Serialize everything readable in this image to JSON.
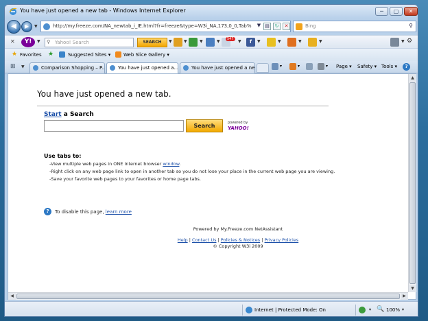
{
  "window": {
    "title": "You have just opened a new tab - Windows Internet Explorer",
    "min_glyph": "─",
    "max_glyph": "▢",
    "close_glyph": "✕"
  },
  "nav": {
    "back_glyph": "◀",
    "forward_glyph": "▶",
    "dropdown_glyph": "▼"
  },
  "address": {
    "url": "http://my.freeze.com/NA_newtab_i_IE.html?fr=freeze&type=W3i_NA,173,0_0,Tab%20Sear",
    "dropdown_glyph": "▼",
    "compat_glyph": "▤",
    "refresh_glyph": "↻",
    "stop_glyph": "✕"
  },
  "search": {
    "placeholder": "Bing",
    "go_glyph": "⚲"
  },
  "yahoo_toolbar": {
    "close_glyph": "✕",
    "logo_text": "Y!",
    "search_placeholder": "Yahoo! Search",
    "search_button": "SEARCH",
    "mail_badge": "547",
    "facebook_text": "f",
    "icon_colors": {
      "bookmark": "#e0a020",
      "arrow": "#3a9a3a",
      "mail": "#4a7fc1",
      "messenger": "#e8c020",
      "news": "#e07020",
      "games": "#e8b020"
    }
  },
  "favorites": {
    "favorites_label": "Favorites",
    "suggested_label": "Suggested Sites ▾",
    "webslice_label": "Web Slice Gallery ▾"
  },
  "tabs": {
    "quicktabs_glyph": "⊞",
    "items": [
      {
        "label": "Comparison Shopping – P..."
      },
      {
        "label": "You have just opened a..."
      },
      {
        "label": "You have just opened a ne..."
      }
    ]
  },
  "commands": {
    "page": "Page ▾",
    "safety": "Safety ▾",
    "tools": "Tools ▾",
    "help": "?"
  },
  "content": {
    "heading": "You have just opened a new tab.",
    "search_title_link": "Start",
    "search_title_rest": " a Search",
    "search_button": "Search",
    "powered_by": "powered by",
    "powered_by_brand": "YAHOO!",
    "tabs_heading": "Use tabs to:",
    "bullet_1_prefix": "-View multiple web pages in ONE Internet browser ",
    "bullet_1_link": "window",
    "bullet_1_suffix": ".",
    "bullet_2": "-Right click on any web page link to open in another tab so you do not lose your place in the current web page you are viewing.",
    "bullet_3": "-Save your favorite web pages to your favorites or home page tabs.",
    "help_glyph": "?",
    "disable_text": "To disable this page, ",
    "learn_more": "learn more",
    "powered_footer": "Powered by My.Freeze.com NetAssistant",
    "footer_help": "Help",
    "footer_contact": "Contact Us",
    "footer_policies": "Policies & Notices",
    "footer_privacy": "Privacy Policies",
    "footer_sep": " | ",
    "copyright": "© Copyright W3i 2009"
  },
  "scroll": {
    "up": "▲",
    "down": "▼",
    "left": "◀",
    "right": "▶"
  },
  "status": {
    "zone": "Internet | Protected Mode: On",
    "zoom": "100%",
    "dropdown_glyph": "▾",
    "zoom_glyph": "🔍"
  }
}
